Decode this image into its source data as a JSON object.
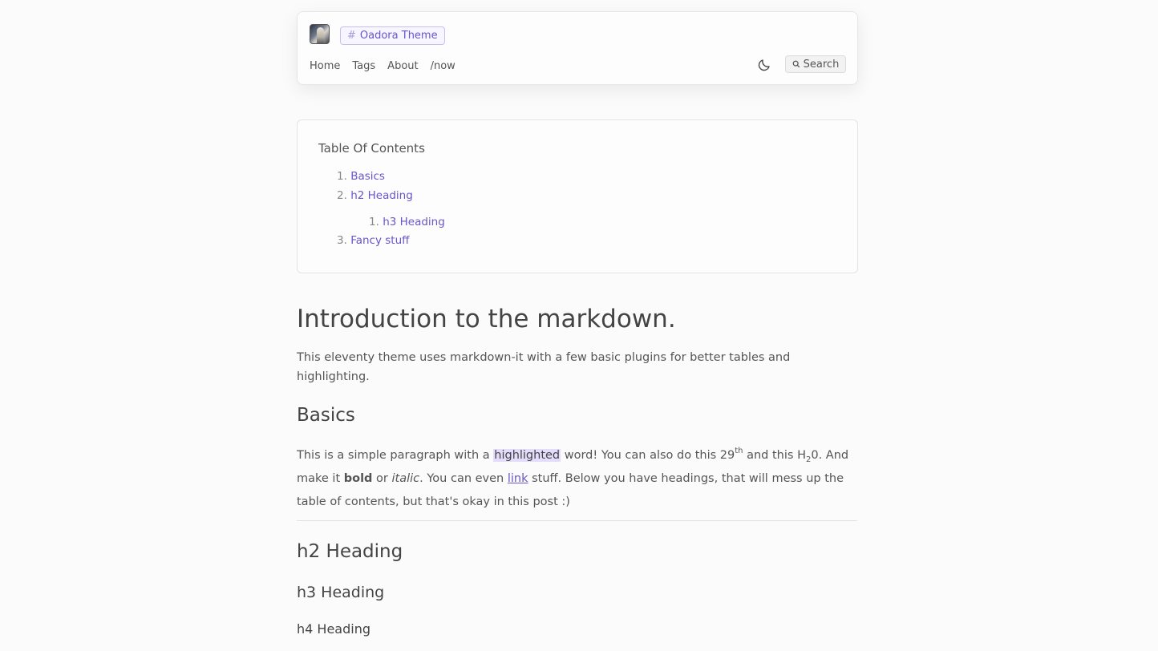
{
  "header": {
    "brand_label": "Oadora Theme",
    "brand_hash": "#",
    "nav": [
      "Home",
      "Tags",
      "About",
      "/now"
    ],
    "search_label": "Search"
  },
  "toc": {
    "title": "Table Of Contents",
    "items": [
      {
        "num": "1.",
        "label": "Basics"
      },
      {
        "num": "2.",
        "label": "h2 Heading"
      },
      {
        "num": "1.",
        "label": "h3 Heading"
      },
      {
        "num": "3.",
        "label": "Fancy stuff"
      }
    ]
  },
  "article": {
    "title": "Introduction to the markdown.",
    "intro": "This eleventy theme uses markdown-it with a few basic plugins for better tables and highlighting.",
    "basics_heading": "Basics",
    "basics": {
      "t1": "This is a simple paragraph with a ",
      "highlight": "highlighted",
      "t2": " word! You can also do this 29",
      "sup": "th",
      "t3": " and this H",
      "sub": "2",
      "t4": "0. And make it ",
      "bold": "bold",
      "t5": " or ",
      "italic": "italic",
      "t6": ". You can even ",
      "link": "link",
      "t7": " stuff. Below you have headings, that will mess up the table of contents, but that's okay in this post :)"
    },
    "h2": "h2 Heading",
    "h3": "h3 Heading",
    "h4": "h4 Heading"
  },
  "colors": {
    "accent": "#6a55c9",
    "highlight": "#e4dcfb",
    "background": "#fbfbfb"
  },
  "icons": [
    "avatar",
    "hash-icon",
    "moon-icon",
    "search-icon"
  ]
}
